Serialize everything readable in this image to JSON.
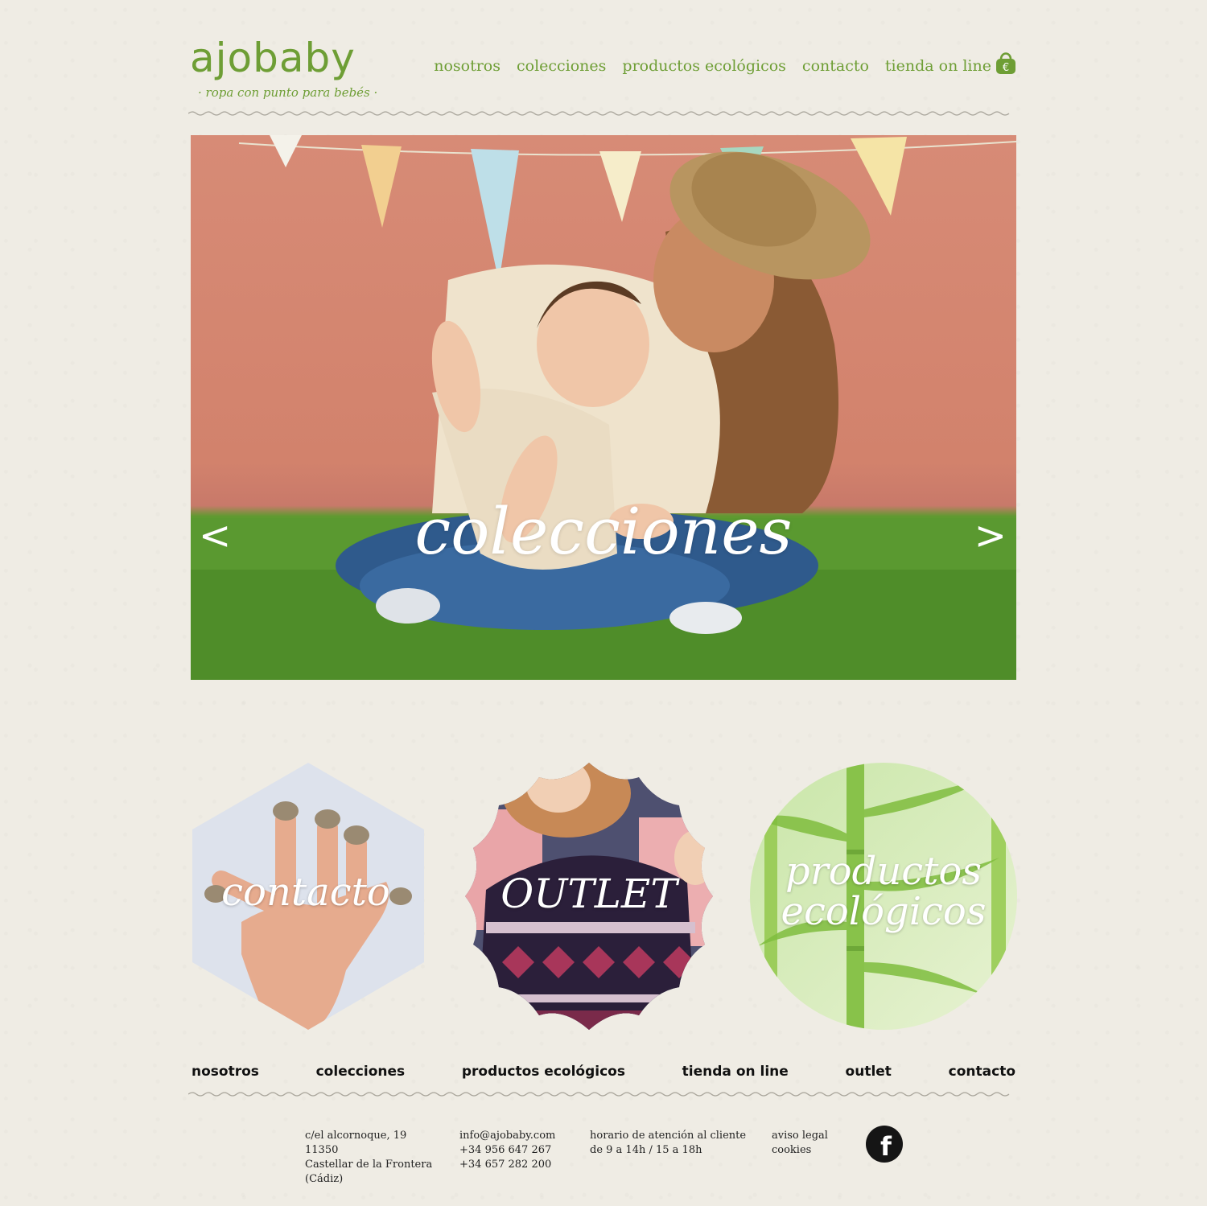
{
  "brand": {
    "logo_text": "ajobaby",
    "tagline": "· ropa con punto para bebés ·",
    "color": "#6e9e35"
  },
  "header_nav": [
    {
      "label": "nosotros"
    },
    {
      "label": "colecciones"
    },
    {
      "label": "productos ecológicos"
    },
    {
      "label": "contacto"
    },
    {
      "label": "tienda on line"
    }
  ],
  "icons": {
    "cart": "shopping-basket-euro-icon",
    "prev": "chevron-left-icon",
    "next": "chevron-right-icon",
    "social": "facebook-icon"
  },
  "hero": {
    "title": "colecciones",
    "prev": "<",
    "next": ">"
  },
  "tiles": [
    {
      "label": "contacto"
    },
    {
      "label": "OUTLET"
    },
    {
      "label": "productos ecológicos",
      "line1": "productos",
      "line2": "ecológicos"
    }
  ],
  "footer_nav": [
    {
      "label": "nosotros"
    },
    {
      "label": "colecciones"
    },
    {
      "label": "productos ecológicos"
    },
    {
      "label": "tienda on line"
    },
    {
      "label": "outlet"
    },
    {
      "label": "contacto"
    }
  ],
  "footer": {
    "address": [
      "c/el alcornoque, 19",
      "11350",
      "Castellar de la Frontera",
      "(Cádiz)"
    ],
    "contact": [
      "info@ajobaby.com",
      "+34 956 647 267",
      "+34 657 282 200"
    ],
    "hours": [
      "horario de atención al cliente",
      "de 9 a 14h / 15 a 18h"
    ],
    "legal": [
      "aviso legal",
      "cookies"
    ],
    "social": "f"
  }
}
